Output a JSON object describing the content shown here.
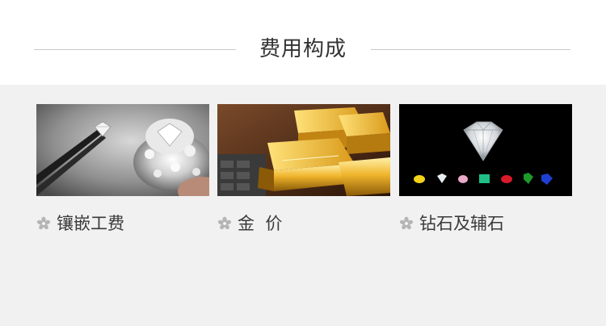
{
  "header": {
    "title": "费用构成"
  },
  "cards": [
    {
      "label": "镶嵌工费",
      "icon": "flower-icon",
      "image": "diamond-ring-tweezers-photo"
    },
    {
      "label": "金  价",
      "icon": "flower-icon",
      "image": "gold-bars-photo"
    },
    {
      "label": "钻石及辅石",
      "icon": "flower-icon",
      "image": "diamond-gemstones-photo"
    }
  ],
  "colors": {
    "background": "#f1f1f1",
    "header_background": "#ffffff",
    "rule": "#c9c9c9",
    "text": "#333333",
    "icon": "#b5b5b5"
  }
}
